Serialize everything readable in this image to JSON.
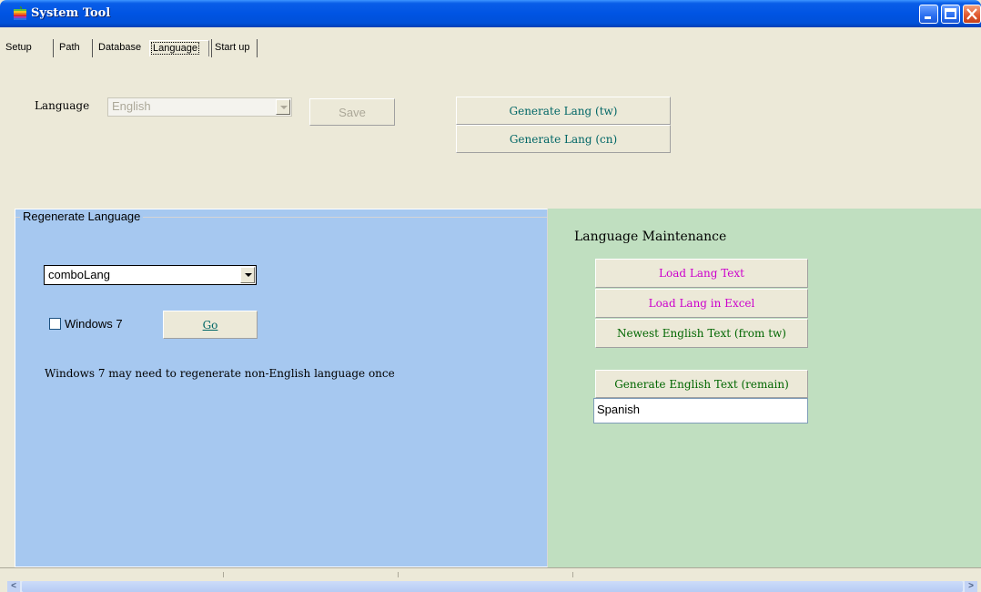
{
  "window": {
    "title": "System Tool"
  },
  "tabs": [
    "Setup",
    "Path",
    "Database",
    "Language",
    "Start up"
  ],
  "active_tab": "Language",
  "language_section": {
    "label": "Language",
    "combo_value": "English",
    "save_label": "Save",
    "generate_tw_label": "Generate Lang (tw)",
    "generate_cn_label": "Generate Lang (cn)"
  },
  "regenerate": {
    "group_title": "Regenerate Language",
    "combo_value": "comboLang",
    "checkbox_label": "Windows 7",
    "checkbox_checked": false,
    "go_label": "Go",
    "note": "Windows 7 may need to regenerate non-English language once"
  },
  "maintenance": {
    "title": "Language Maintenance",
    "load_text_label": "Load Lang Text",
    "load_excel_label": "Load Lang in Excel",
    "newest_english_label": "Newest English Text (from tw)",
    "generate_english_label": "Generate English Text (remain)",
    "language_input_value": "Spanish"
  },
  "colors": {
    "left_panel": "#a6c8f0",
    "right_panel": "#c0dfc0",
    "teal_text": "#006666",
    "magenta_text": "#cc00cc",
    "green_text": "#006600"
  }
}
